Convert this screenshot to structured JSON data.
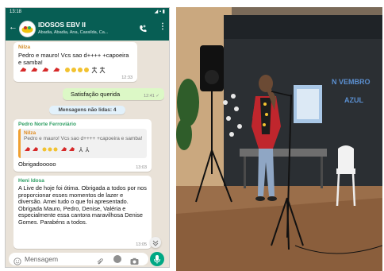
{
  "status_bar": {
    "time": "13:18",
    "icons": "◢ ▪ ▮"
  },
  "header": {
    "back_icon": "arrow-left-icon",
    "title": "IDOSOS EBV II",
    "members": "Abadia, Abadia, Ana, Cassilda, Ca...",
    "call_icon": "phone-plus-icon",
    "menu_icon": "more-vertical-icon",
    "header_color": "#075e54"
  },
  "messages": [
    {
      "sender": "Nilza",
      "text": "Pedro e mauro! Vcs sao d++++ +capoeira e samba!",
      "time": "12:33"
    },
    {
      "text": "Satisfação querida",
      "time": "12:41 ✓"
    }
  ],
  "unread_label": "Mensagens não lidas: 4",
  "reply_message": {
    "sender": "Pedro Norte Ferroviário",
    "quote_sender": "Nilza",
    "quote_text": "Pedro e mauro! Vcs sao d++++ +capoeira e samba!",
    "text": "Obrigadooooo",
    "time": "13:03"
  },
  "last_message": {
    "sender": "Heni Idosa",
    "text": "A Live de hoje foi ótima. Obrigada a todos por nos proporcionar esses momentos de lazer e diversão. Amei tudo o que foi apresentado. Obrigada Mauro, Pedro, Denise, Valéria e especialmente essa cantora maravilhosa Denise Gomes. Parabéns a todos.",
    "time": "13:05"
  },
  "composer": {
    "placeholder": "Mensagem"
  },
  "photo": {
    "wall_text_line1": "N VEMBRO",
    "wall_text_line2": "AZUL"
  }
}
